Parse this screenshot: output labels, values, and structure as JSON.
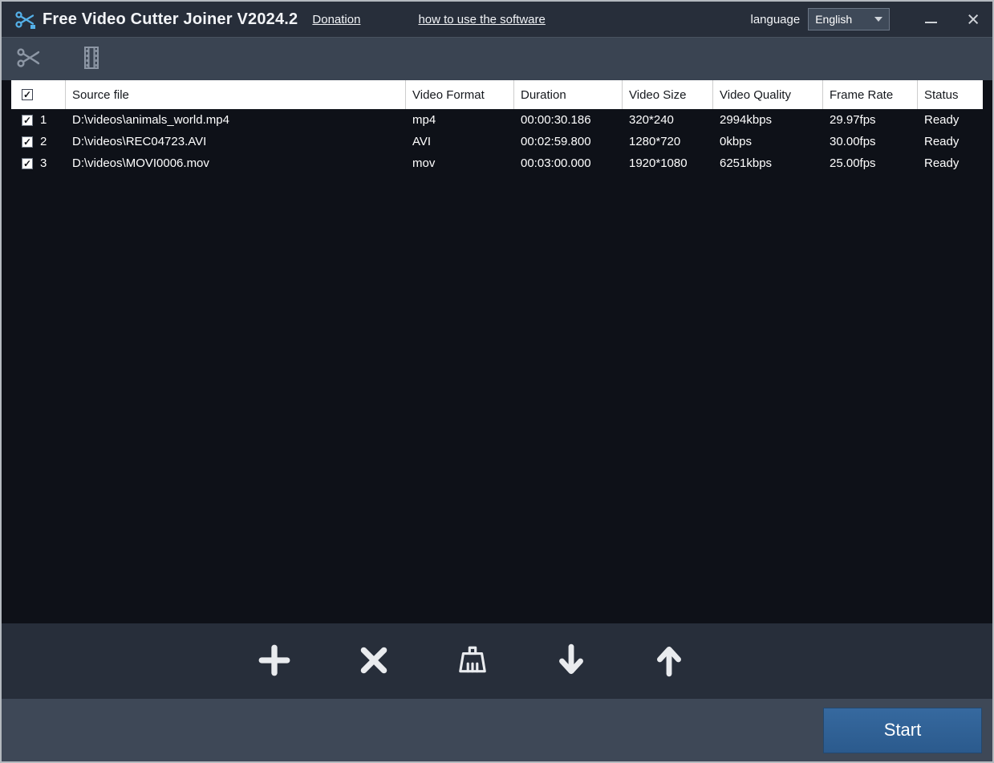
{
  "titlebar": {
    "title": "Free Video Cutter Joiner V2024.2",
    "donation": "Donation",
    "help": "how to use the software",
    "language_label": "language",
    "language_value": "English"
  },
  "table": {
    "headers": [
      "Source file",
      "Video Format",
      "Duration",
      "Video Size",
      "Video Quality",
      "Frame Rate",
      "Status"
    ],
    "rows": [
      {
        "num": "1",
        "checked": true,
        "source": "D:\\videos\\animals_world.mp4",
        "format": "mp4",
        "duration": "00:00:30.186",
        "size": "320*240",
        "quality": "2994kbps",
        "framerate": "29.97fps",
        "status": "Ready"
      },
      {
        "num": "2",
        "checked": true,
        "source": "D:\\videos\\REC04723.AVI",
        "format": "AVI",
        "duration": "00:02:59.800",
        "size": "1280*720",
        "quality": "0kbps",
        "framerate": "30.00fps",
        "status": "Ready"
      },
      {
        "num": "3",
        "checked": true,
        "source": "D:\\videos\\MOVI0006.mov",
        "format": "mov",
        "duration": "00:03:00.000",
        "size": "1920*1080",
        "quality": "6251kbps",
        "framerate": "25.00fps",
        "status": "Ready"
      }
    ]
  },
  "footer": {
    "start": "Start"
  },
  "ui": {
    "check": "✓",
    "close": "×"
  },
  "icons": [
    "app-logo-icon",
    "scissors-icon",
    "film-strip-icon",
    "plus-icon",
    "x-icon",
    "broom-icon",
    "arrow-down-icon",
    "arrow-up-icon",
    "chevron-down-icon",
    "minimize-icon"
  ],
  "colors": {
    "titlebar": "#272e3a",
    "toolbar": "#3a4452",
    "table_bg": "#0e1118",
    "header_bg": "#ffffff",
    "icon_strip": "#272e3a",
    "bottom_bar": "#3e4857",
    "start_button": "#2e6096",
    "logo_blue": "#54b0e8"
  }
}
